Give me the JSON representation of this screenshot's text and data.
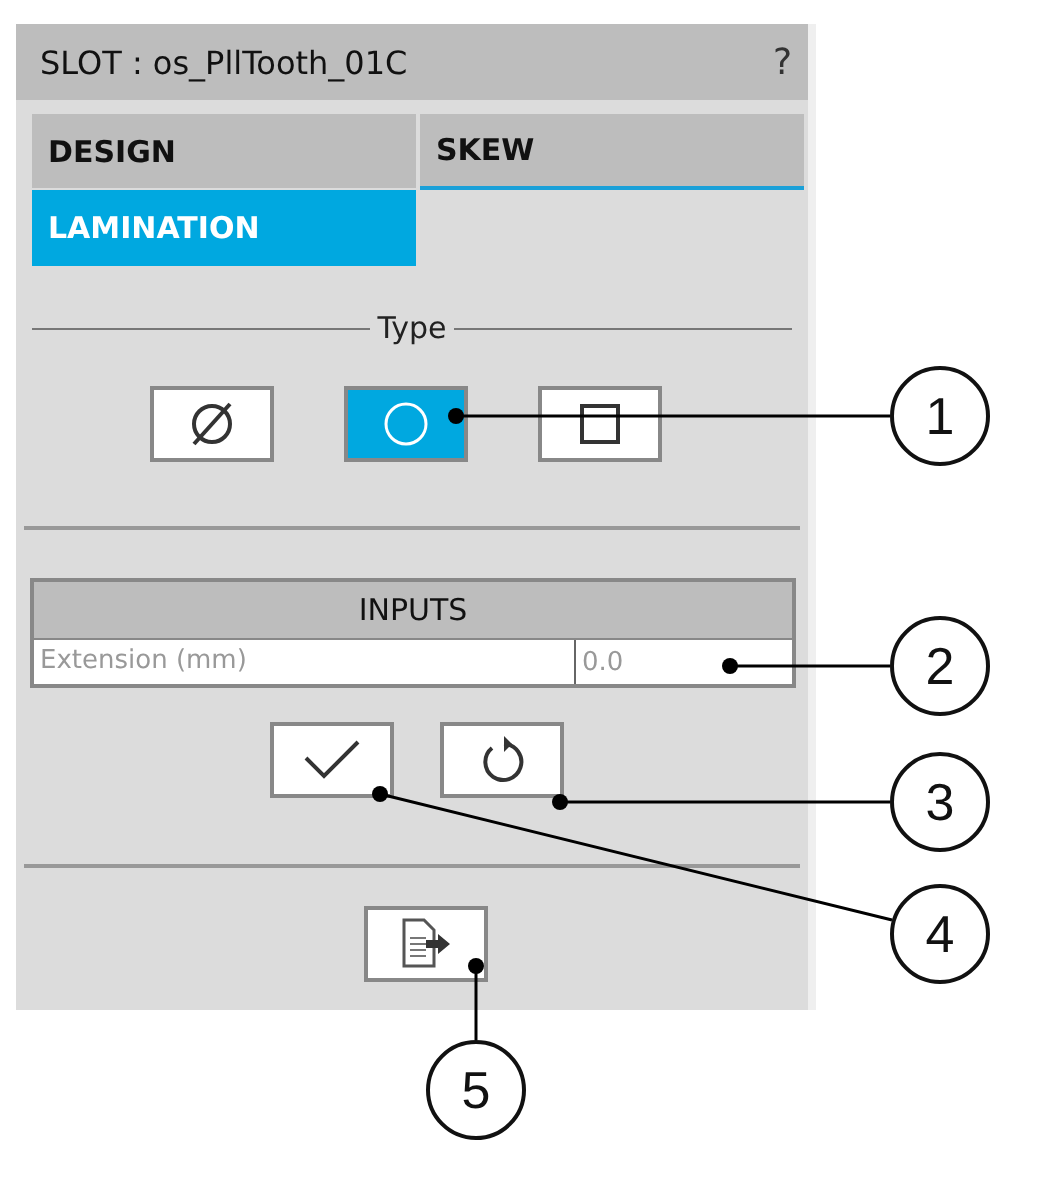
{
  "window": {
    "title": "SLOT : os_PllTooth_01C",
    "help": "?"
  },
  "tabs": [
    {
      "label": "DESIGN",
      "selected": false
    },
    {
      "label": "SKEW",
      "selected": false
    },
    {
      "label": "LAMINATION",
      "selected": true
    }
  ],
  "type_group": {
    "label": "Type",
    "options": [
      {
        "kind": "slashed-circle",
        "selected": false
      },
      {
        "kind": "circle",
        "selected": true
      },
      {
        "kind": "square",
        "selected": false
      }
    ]
  },
  "inputs": {
    "title": "INPUTS",
    "rows": [
      {
        "label": "Extension (mm)",
        "value": "0.0"
      }
    ]
  },
  "actions": [
    {
      "kind": "check"
    },
    {
      "kind": "reset"
    }
  ],
  "export": {
    "kind": "export"
  },
  "callouts": [
    {
      "number": "1"
    },
    {
      "number": "2"
    },
    {
      "number": "3"
    },
    {
      "number": "4"
    },
    {
      "number": "5"
    }
  ]
}
